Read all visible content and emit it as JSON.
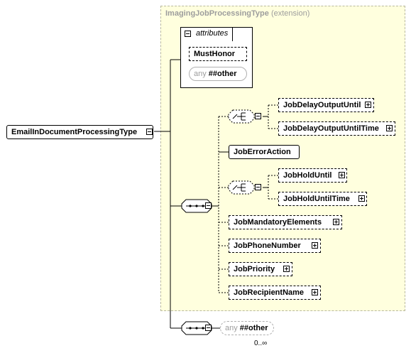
{
  "root": {
    "name": "EmailInDocumentProcessingType"
  },
  "extension": {
    "base_name": "ImagingJobProcessingType",
    "kind": "(extension)"
  },
  "attributes": {
    "label": "attributes",
    "items": [
      {
        "name": "MustHonor"
      },
      {
        "any": "any",
        "namespace": "##other"
      }
    ]
  },
  "choice1": [
    "JobDelayOutputUntil",
    "JobDelayOutputUntilTime"
  ],
  "error_action": "JobErrorAction",
  "choice2": [
    "JobHoldUntil",
    "JobHoldUntilTime"
  ],
  "elements": [
    "JobMandatoryElements",
    "JobPhoneNumber",
    "JobPriority",
    "JobRecipientName"
  ],
  "wildcard": {
    "any": "any",
    "namespace": "##other",
    "occurrence": "0..∞"
  }
}
